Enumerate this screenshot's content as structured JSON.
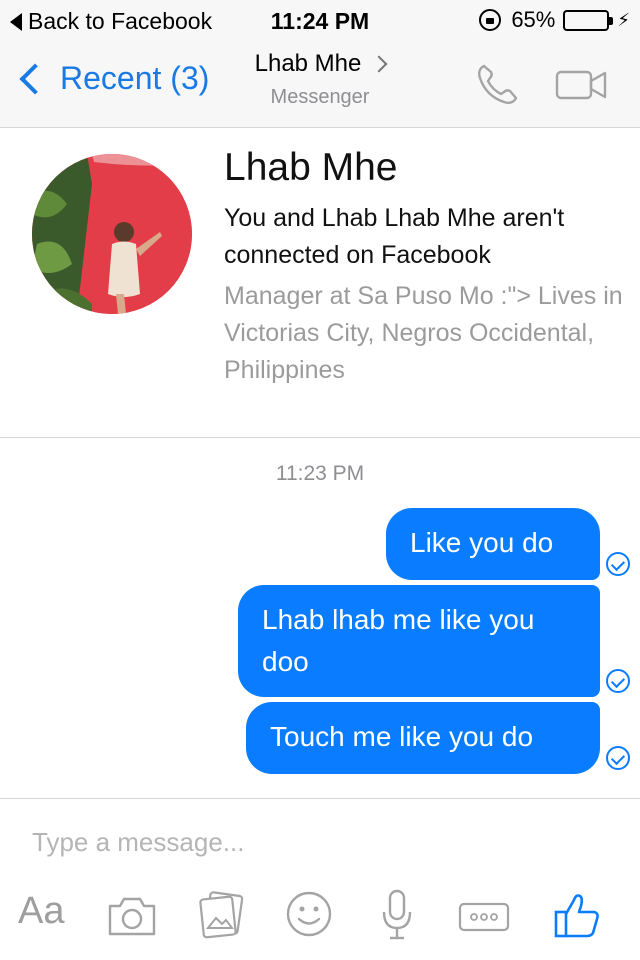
{
  "status_bar": {
    "back_label": "Back to Facebook",
    "time": "11:24 PM",
    "battery": "65%",
    "battery_level": 0.65
  },
  "nav": {
    "back_label": "Recent (3)",
    "contact_name": "Lhab Mhe",
    "subtitle": "Messenger",
    "icons": [
      "phone-icon",
      "video-icon"
    ]
  },
  "profile": {
    "name": "Lhab Mhe",
    "connection": "You and Lhab Lhab Mhe aren't connected on Facebook",
    "details": "Manager at Sa Puso  Mo  :\"> Lives in Victorias City, Negros Occidental, Philippines"
  },
  "messages": {
    "timestamp": "11:23 PM",
    "items": [
      {
        "text": "Like you do"
      },
      {
        "text": "Lhab lhab me like you doo"
      },
      {
        "text": "Touch me like you do"
      }
    ]
  },
  "composer": {
    "placeholder": "Type a message...",
    "aa_label": "Aa",
    "icons": [
      "text-format-icon",
      "camera-icon",
      "gallery-icon",
      "emoji-icon",
      "microphone-icon",
      "more-icon",
      "like-icon"
    ]
  },
  "colors": {
    "accent": "#0a7cff",
    "link": "#1a7ae4",
    "battery": "#4cd964",
    "avatar_bg": "#e33d49"
  }
}
